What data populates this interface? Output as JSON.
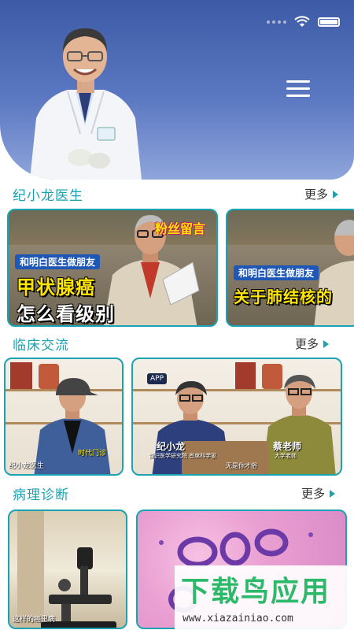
{
  "header": {
    "menu_icon": "hamburger-menu-icon",
    "colors": {
      "hero_top": "#3d5aa6",
      "hero_bottom": "#8fa5da"
    }
  },
  "sections": [
    {
      "title": "纪小龙医生",
      "more_label": "更多"
    },
    {
      "title": "临床交流",
      "more_label": "更多"
    },
    {
      "title": "病理诊断",
      "more_label": "更多"
    }
  ],
  "videos": [
    {
      "tag": "粉丝留言",
      "banner": "和明白医生做朋友",
      "line1": "甲状腺癌",
      "line2": "怎么看级别"
    },
    {
      "banner": "和明白医生做朋友",
      "line1": "关于肺结核的"
    }
  ],
  "clinical": [
    {
      "caption_left": "纪小龙医生",
      "caption_right": "时代门诊"
    },
    {
      "logo": "APP",
      "name_left": "纪小龙",
      "title_left": "智识医学研究院 首席科学家",
      "name_right": "蔡老师",
      "title_right": "大学老师",
      "subtitle": "无是你才俗"
    }
  ],
  "pathology": [
    {
      "caption": "这样的癌里病..."
    },
    {
      "caption": ""
    }
  ],
  "watermark": {
    "main": "下载鸟应用",
    "url": "www.xiazainiao.com"
  },
  "accent_color": "#1aa3b2"
}
